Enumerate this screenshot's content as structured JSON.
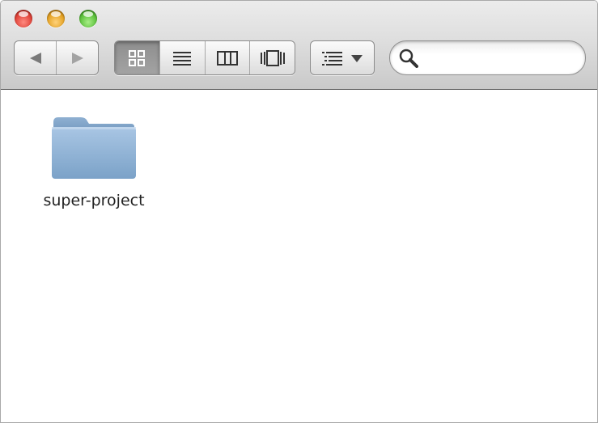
{
  "window": {
    "traffic_lights": [
      {
        "name": "close",
        "color": "#e0443a"
      },
      {
        "name": "minimize",
        "color": "#e5a326"
      },
      {
        "name": "zoom",
        "color": "#5cc13c"
      }
    ]
  },
  "toolbar": {
    "nav": {
      "back_icon": "triangle-left-icon",
      "forward_icon": "triangle-right-icon"
    },
    "view_modes": [
      {
        "mode": "icon",
        "icon": "icon-view-icon",
        "selected": true
      },
      {
        "mode": "list",
        "icon": "list-view-icon",
        "selected": false
      },
      {
        "mode": "column",
        "icon": "column-view-icon",
        "selected": false
      },
      {
        "mode": "cover-flow",
        "icon": "cover-flow-icon",
        "selected": false
      }
    ],
    "arrange": {
      "icon": "arrange-list-icon",
      "dropdown_icon": "chevron-down-icon"
    },
    "search": {
      "value": "",
      "placeholder": "",
      "icon": "magnifier-icon"
    }
  },
  "content": {
    "items": [
      {
        "name": "super-project",
        "kind": "folder",
        "icon": "folder-icon",
        "color": "#8fb3d6"
      }
    ]
  }
}
